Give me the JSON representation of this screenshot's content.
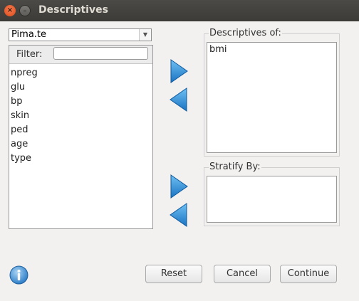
{
  "window": {
    "title": "Descriptives",
    "close_icon": "×",
    "minimize_icon": "–"
  },
  "dataset": {
    "selected": "Pima.te"
  },
  "filter": {
    "label": "Filter:",
    "value": ""
  },
  "variables": [
    "npreg",
    "glu",
    "bp",
    "skin",
    "ped",
    "age",
    "type"
  ],
  "descriptives_of": {
    "label": "Descriptives of:",
    "items": [
      "bmi"
    ]
  },
  "stratify_by": {
    "label": "Stratify By:",
    "items": []
  },
  "buttons": {
    "reset": "Reset",
    "cancel": "Cancel",
    "continue": "Continue"
  },
  "colors": {
    "arrow_blue": "#2a8fd6",
    "titlebar": "#3c3b37",
    "close_orange": "#e95420"
  }
}
